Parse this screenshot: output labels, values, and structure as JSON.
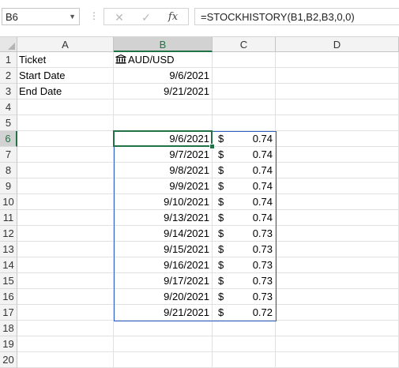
{
  "namebox": {
    "value": "B6",
    "caret_icon": "chevron-down-icon"
  },
  "formula_bar": {
    "cancel_icon": "✕",
    "enter_icon": "✓",
    "fx_label": "fx",
    "formula": "=STOCKHISTORY(B1,B2,B3,0,0)"
  },
  "columns": [
    "A",
    "B",
    "C",
    "D"
  ],
  "rows": [
    "1",
    "2",
    "3",
    "4",
    "5",
    "6",
    "7",
    "8",
    "9",
    "10",
    "11",
    "12",
    "13",
    "14",
    "15",
    "16",
    "17",
    "18",
    "19",
    "20"
  ],
  "cells": {
    "A1": "Ticket",
    "B1": "AUD/USD",
    "A2": "Start Date",
    "B2": "9/6/2021",
    "A3": "End Date",
    "B3": "9/21/2021"
  },
  "history": [
    {
      "date": "9/6/2021",
      "currency": "$",
      "close": "0.74"
    },
    {
      "date": "9/7/2021",
      "currency": "$",
      "close": "0.74"
    },
    {
      "date": "9/8/2021",
      "currency": "$",
      "close": "0.74"
    },
    {
      "date": "9/9/2021",
      "currency": "$",
      "close": "0.74"
    },
    {
      "date": "9/10/2021",
      "currency": "$",
      "close": "0.74"
    },
    {
      "date": "9/13/2021",
      "currency": "$",
      "close": "0.74"
    },
    {
      "date": "9/14/2021",
      "currency": "$",
      "close": "0.73"
    },
    {
      "date": "9/15/2021",
      "currency": "$",
      "close": "0.73"
    },
    {
      "date": "9/16/2021",
      "currency": "$",
      "close": "0.73"
    },
    {
      "date": "9/17/2021",
      "currency": "$",
      "close": "0.73"
    },
    {
      "date": "9/20/2021",
      "currency": "$",
      "close": "0.73"
    },
    {
      "date": "9/21/2021",
      "currency": "$",
      "close": "0.72"
    }
  ],
  "colors": {
    "accent": "#217346",
    "selection": "#2e5fc9",
    "header_bg": "#f3f3f3"
  }
}
